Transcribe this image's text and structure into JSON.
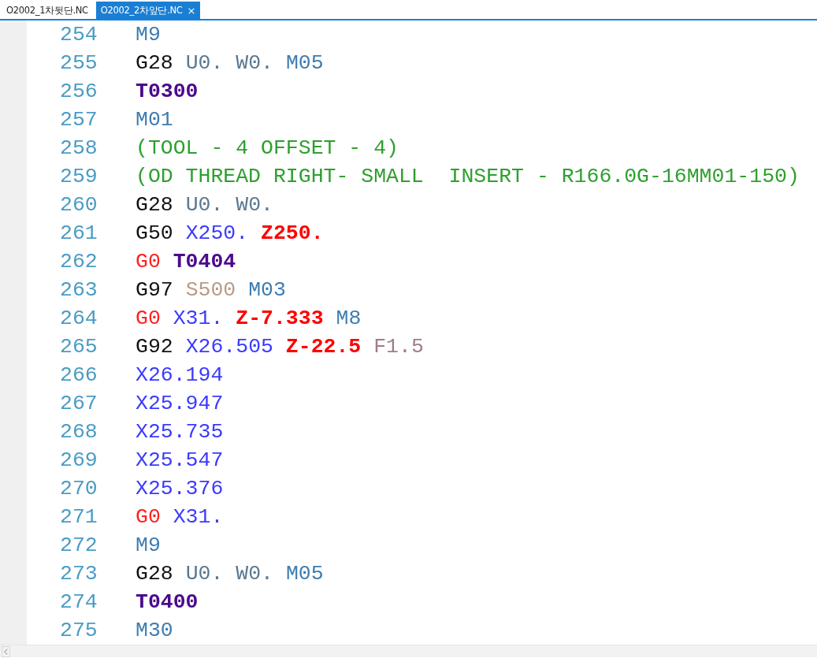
{
  "tabs": [
    {
      "label": "O2002_1차뒷단.NC",
      "selected": false
    },
    {
      "label": "O2002_2차앞단.NC",
      "selected": true
    }
  ],
  "close_glyph": "×",
  "lines": [
    {
      "number": "254",
      "tokens": [
        {
          "kind": "m",
          "text": "M9"
        }
      ]
    },
    {
      "number": "255",
      "tokens": [
        {
          "kind": "g",
          "text": "G28"
        },
        {
          "kind": "axis",
          "text": "U0."
        },
        {
          "kind": "axis",
          "text": "W0."
        },
        {
          "kind": "m",
          "text": "M05"
        }
      ]
    },
    {
      "number": "256",
      "tokens": [
        {
          "kind": "tool",
          "text": "T0300"
        }
      ]
    },
    {
      "number": "257",
      "tokens": [
        {
          "kind": "m",
          "text": "M01"
        }
      ]
    },
    {
      "number": "258",
      "tokens": [
        {
          "kind": "comment",
          "text": "(TOOL - 4 OFFSET - 4)"
        }
      ]
    },
    {
      "number": "259",
      "tokens": [
        {
          "kind": "comment",
          "text": "(OD THREAD RIGHT- SMALL  INSERT - R166.0G-16MM01-150)"
        }
      ]
    },
    {
      "number": "260",
      "tokens": [
        {
          "kind": "g",
          "text": "G28"
        },
        {
          "kind": "axis",
          "text": "U0."
        },
        {
          "kind": "axis",
          "text": "W0."
        }
      ]
    },
    {
      "number": "261",
      "tokens": [
        {
          "kind": "g",
          "text": "G50"
        },
        {
          "kind": "x",
          "text": "X250."
        },
        {
          "kind": "z",
          "text": "Z250."
        }
      ]
    },
    {
      "number": "262",
      "tokens": [
        {
          "kind": "rapid",
          "text": "G0"
        },
        {
          "kind": "tool",
          "text": "T0404"
        }
      ]
    },
    {
      "number": "263",
      "tokens": [
        {
          "kind": "g",
          "text": "G97"
        },
        {
          "kind": "s",
          "text": "S500"
        },
        {
          "kind": "m",
          "text": "M03"
        }
      ]
    },
    {
      "number": "264",
      "tokens": [
        {
          "kind": "rapid",
          "text": "G0"
        },
        {
          "kind": "x",
          "text": "X31."
        },
        {
          "kind": "z",
          "text": "Z-7.333"
        },
        {
          "kind": "m",
          "text": "M8"
        }
      ]
    },
    {
      "number": "265",
      "tokens": [
        {
          "kind": "g",
          "text": "G92"
        },
        {
          "kind": "x",
          "text": "X26.505"
        },
        {
          "kind": "z",
          "text": "Z-22.5"
        },
        {
          "kind": "f",
          "text": "F1.5"
        }
      ]
    },
    {
      "number": "266",
      "tokens": [
        {
          "kind": "x",
          "text": "X26.194"
        }
      ]
    },
    {
      "number": "267",
      "tokens": [
        {
          "kind": "x",
          "text": "X25.947"
        }
      ]
    },
    {
      "number": "268",
      "tokens": [
        {
          "kind": "x",
          "text": "X25.735"
        }
      ]
    },
    {
      "number": "269",
      "tokens": [
        {
          "kind": "x",
          "text": "X25.547"
        }
      ]
    },
    {
      "number": "270",
      "tokens": [
        {
          "kind": "x",
          "text": "X25.376"
        }
      ]
    },
    {
      "number": "271",
      "tokens": [
        {
          "kind": "rapid",
          "text": "G0"
        },
        {
          "kind": "x",
          "text": "X31."
        }
      ]
    },
    {
      "number": "272",
      "tokens": [
        {
          "kind": "m",
          "text": "M9"
        }
      ]
    },
    {
      "number": "273",
      "tokens": [
        {
          "kind": "g",
          "text": "G28"
        },
        {
          "kind": "axis",
          "text": "U0."
        },
        {
          "kind": "axis",
          "text": "W0."
        },
        {
          "kind": "m",
          "text": "M05"
        }
      ]
    },
    {
      "number": "274",
      "tokens": [
        {
          "kind": "tool",
          "text": "T0400"
        }
      ]
    },
    {
      "number": "275",
      "tokens": [
        {
          "kind": "m",
          "text": "M30"
        }
      ]
    }
  ]
}
